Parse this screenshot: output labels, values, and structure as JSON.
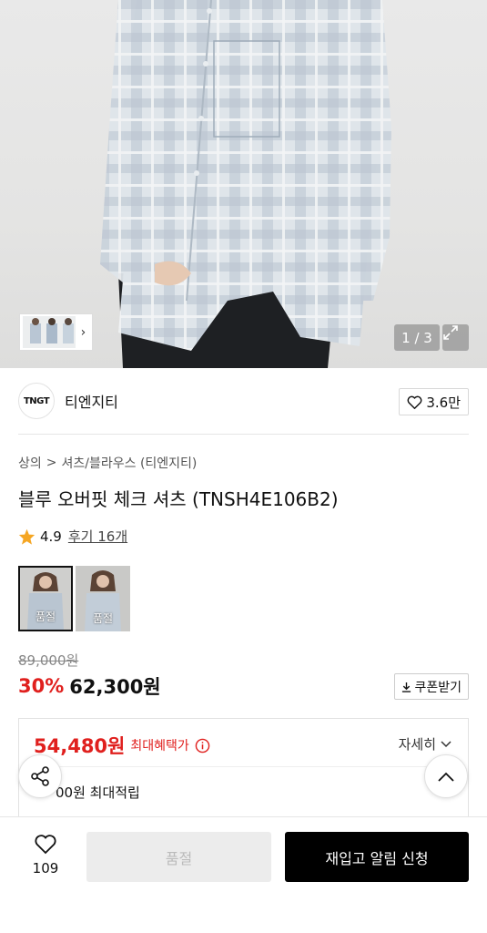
{
  "gallery": {
    "counter": "1 / 3",
    "thumb_chevron": "›"
  },
  "brand": {
    "logo_text": "TNGT",
    "name": "티엔지티",
    "like_count": "3.6만"
  },
  "breadcrumb": {
    "items": [
      "상의",
      "셔츠/블라우스 (티엔지티)"
    ],
    "separator": ">"
  },
  "product": {
    "title": "블루 오버핏 체크 셔츠 (TNSH4E106B2)",
    "rating": "4.9",
    "review_label": "후기 16개"
  },
  "swatches": [
    {
      "label": "품절",
      "selected": true
    },
    {
      "label": "품절",
      "selected": false
    }
  ],
  "price": {
    "original": "89,000원",
    "discount": "30%",
    "sale": "62,300원",
    "coupon_label": "쿠폰받기"
  },
  "benefit": {
    "max_price": "54,480원",
    "max_label": "최대혜택가",
    "detail_label": "자세히",
    "points_label": "00원 최대적립"
  },
  "bottom": {
    "wish_count": "109",
    "soldout_label": "품절",
    "restock_label": "재입고 알림 신청"
  },
  "colors": {
    "accent_red": "#e0201e",
    "primary_black": "#000000",
    "star": "#f5a623"
  }
}
